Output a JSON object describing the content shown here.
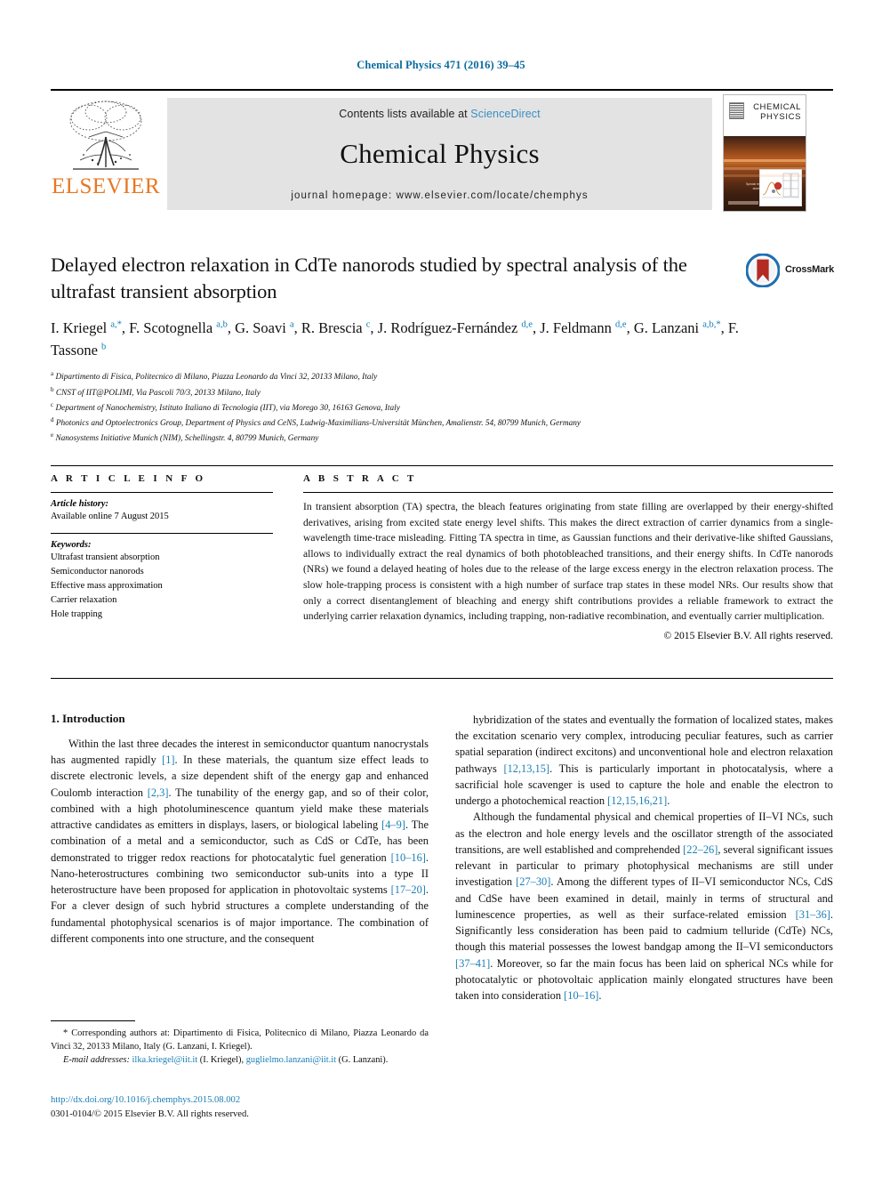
{
  "running_head": "Chemical Physics 471 (2016) 39–45",
  "masthead": {
    "publisher": "ELSEVIER",
    "contents_prefix": "Contents lists available at ",
    "sciencedirect": "ScienceDirect",
    "journal_title": "Chemical Physics",
    "homepage": "journal homepage: www.elsevier.com/locate/chemphys",
    "cover_title_line1": "CHEMICAL",
    "cover_title_line2": "PHYSICS",
    "cover_caption": "Special research on the 2 dimensional in atomic energy and material science",
    "link_color": "#3a8fc4",
    "publisher_color": "#E87722"
  },
  "article": {
    "title": "Delayed electron relaxation in CdTe nanorods studied by spectral analysis of the ultrafast transient absorption",
    "crossmark_label": "CrossMark",
    "authors_html": "I. Kriegel <sup>a,*</sup>, F. Scotognella <sup>a,b</sup>, G. Soavi <sup>a</sup>, R. Brescia <sup>c</sup>, J. Rodríguez-Fernández <sup>d,e</sup>, J. Feldmann <sup>d,e</sup>, G. Lanzani <sup>a,b,*</sup>, F. Tassone <sup>b</sup>",
    "affiliations": [
      {
        "mark": "a",
        "text": "Dipartimento di Fisica, Politecnico di Milano, Piazza Leonardo da Vinci 32, 20133 Milano, Italy"
      },
      {
        "mark": "b",
        "text": "CNST of IIT@POLIMI, Via Pascoli 70/3, 20133 Milano, Italy"
      },
      {
        "mark": "c",
        "text": "Department of Nanochemistry, Istituto Italiano di Tecnologia (IIT), via Morego 30, 16163 Genova, Italy"
      },
      {
        "mark": "d",
        "text": "Photonics and Optoelectronics Group, Department of Physics and CeNS, Ludwig-Maximilians-Universität München, Amalienstr. 54, 80799 Munich, Germany"
      },
      {
        "mark": "e",
        "text": "Nanosystems Initiative Munich (NIM), Schellingstr. 4, 80799 Munich, Germany"
      }
    ]
  },
  "article_info": {
    "heading": "A R T I C L E   I N F O",
    "history_label": "Article history:",
    "history_value": "Available online 7 August 2015",
    "keywords_label": "Keywords:",
    "keywords": [
      "Ultrafast transient absorption",
      "Semiconductor nanorods",
      "Effective mass approximation",
      "Carrier relaxation",
      "Hole trapping"
    ]
  },
  "abstract": {
    "heading": "A B S T R A C T",
    "text": "In transient absorption (TA) spectra, the bleach features originating from state filling are overlapped by their energy-shifted derivatives, arising from excited state energy level shifts. This makes the direct extraction of carrier dynamics from a single-wavelength time-trace misleading. Fitting TA spectra in time, as Gaussian functions and their derivative-like shifted Gaussians, allows to individually extract the real dynamics of both photobleached transitions, and their energy shifts. In CdTe nanorods (NRs) we found a delayed heating of holes due to the release of the large excess energy in the electron relaxation process. The slow hole-trapping process is consistent with a high number of surface trap states in these model NRs. Our results show that only a correct disentanglement of bleaching and energy shift contributions provides a reliable framework to extract the underlying carrier relaxation dynamics, including trapping, non-radiative recombination, and eventually carrier multiplication.",
    "copyright": "© 2015 Elsevier B.V. All rights reserved."
  },
  "body": {
    "section_heading": "1. Introduction",
    "left_paragraph_html": "Within the last three decades the interest in semiconductor quantum nanocrystals has augmented rapidly <span class=\"ref\">[1]</span>. In these materials, the quantum size effect leads to discrete electronic levels, a size dependent shift of the energy gap and enhanced Coulomb interaction <span class=\"ref\">[2,3]</span>. The tunability of the energy gap, and so of their color, combined with a high photoluminescence quantum yield make these materials attractive candidates as emitters in displays, lasers, or biological labeling <span class=\"ref\">[4–9]</span>. The combination of a metal and a semiconductor, such as CdS or CdTe, has been demonstrated to trigger redox reactions for photocatalytic fuel generation <span class=\"ref\">[10–16]</span>. Nano-heterostructures combining two semiconductor sub-units into a type II heterostructure have been proposed for application in photovoltaic systems <span class=\"ref\">[17–20]</span>. For a clever design of such hybrid structures a complete understanding of the fundamental photophysical scenarios is of major importance. The combination of different components into one structure, and the consequent",
    "right_paragraph1_html": "hybridization of the states and eventually the formation of localized states, makes the excitation scenario very complex, introducing peculiar features, such as carrier spatial separation (indirect excitons) and unconventional hole and electron relaxation pathways <span class=\"ref\">[12,13,15]</span>. This is particularly important in photocatalysis, where a sacrificial hole scavenger is used to capture the hole and enable the electron to undergo a photochemical reaction <span class=\"ref\">[12,15,16,21]</span>.",
    "right_paragraph2_html": "Although the fundamental physical and chemical properties of II–VI NCs, such as the electron and hole energy levels and the oscillator strength of the associated transitions, are well established and comprehended <span class=\"ref\">[22–26]</span>, several significant issues relevant in particular to primary photophysical mechanisms are still under investigation <span class=\"ref\">[27–30]</span>. Among the different types of II–VI semiconductor NCs, CdS and CdSe have been examined in detail, mainly in terms of structural and luminescence properties, as well as their surface-related emission <span class=\"ref\">[31–36]</span>. Significantly less consideration has been paid to cadmium telluride (CdTe) NCs, though this material possesses the lowest bandgap among the II–VI semiconductors <span class=\"ref\">[37–41]</span>. Moreover, so far the main focus has been laid on spherical NCs while for photocatalytic or photovoltaic application mainly elongated structures have been taken into consideration <span class=\"ref\">[10–16]</span>."
  },
  "footnote": {
    "corresponding_html": "* Corresponding authors at: Dipartimento di Fisica, Politecnico di Milano, Piazza Leonardo da Vinci 32, 20133 Milano, Italy (G. Lanzani, I. Kriegel).",
    "email_html": "<span class=\"em\">E-mail addresses:</span> <span class=\"mail\">ilka.kriegel@iit.it</span> (I. Kriegel), <span class=\"mail\">guglielmo.lanzani@iit.it</span> (G. Lanzani)."
  },
  "footer": {
    "doi": "http://dx.doi.org/10.1016/j.chemphys.2015.08.002",
    "issn": "0301-0104/© 2015 Elsevier B.V. All rights reserved."
  }
}
